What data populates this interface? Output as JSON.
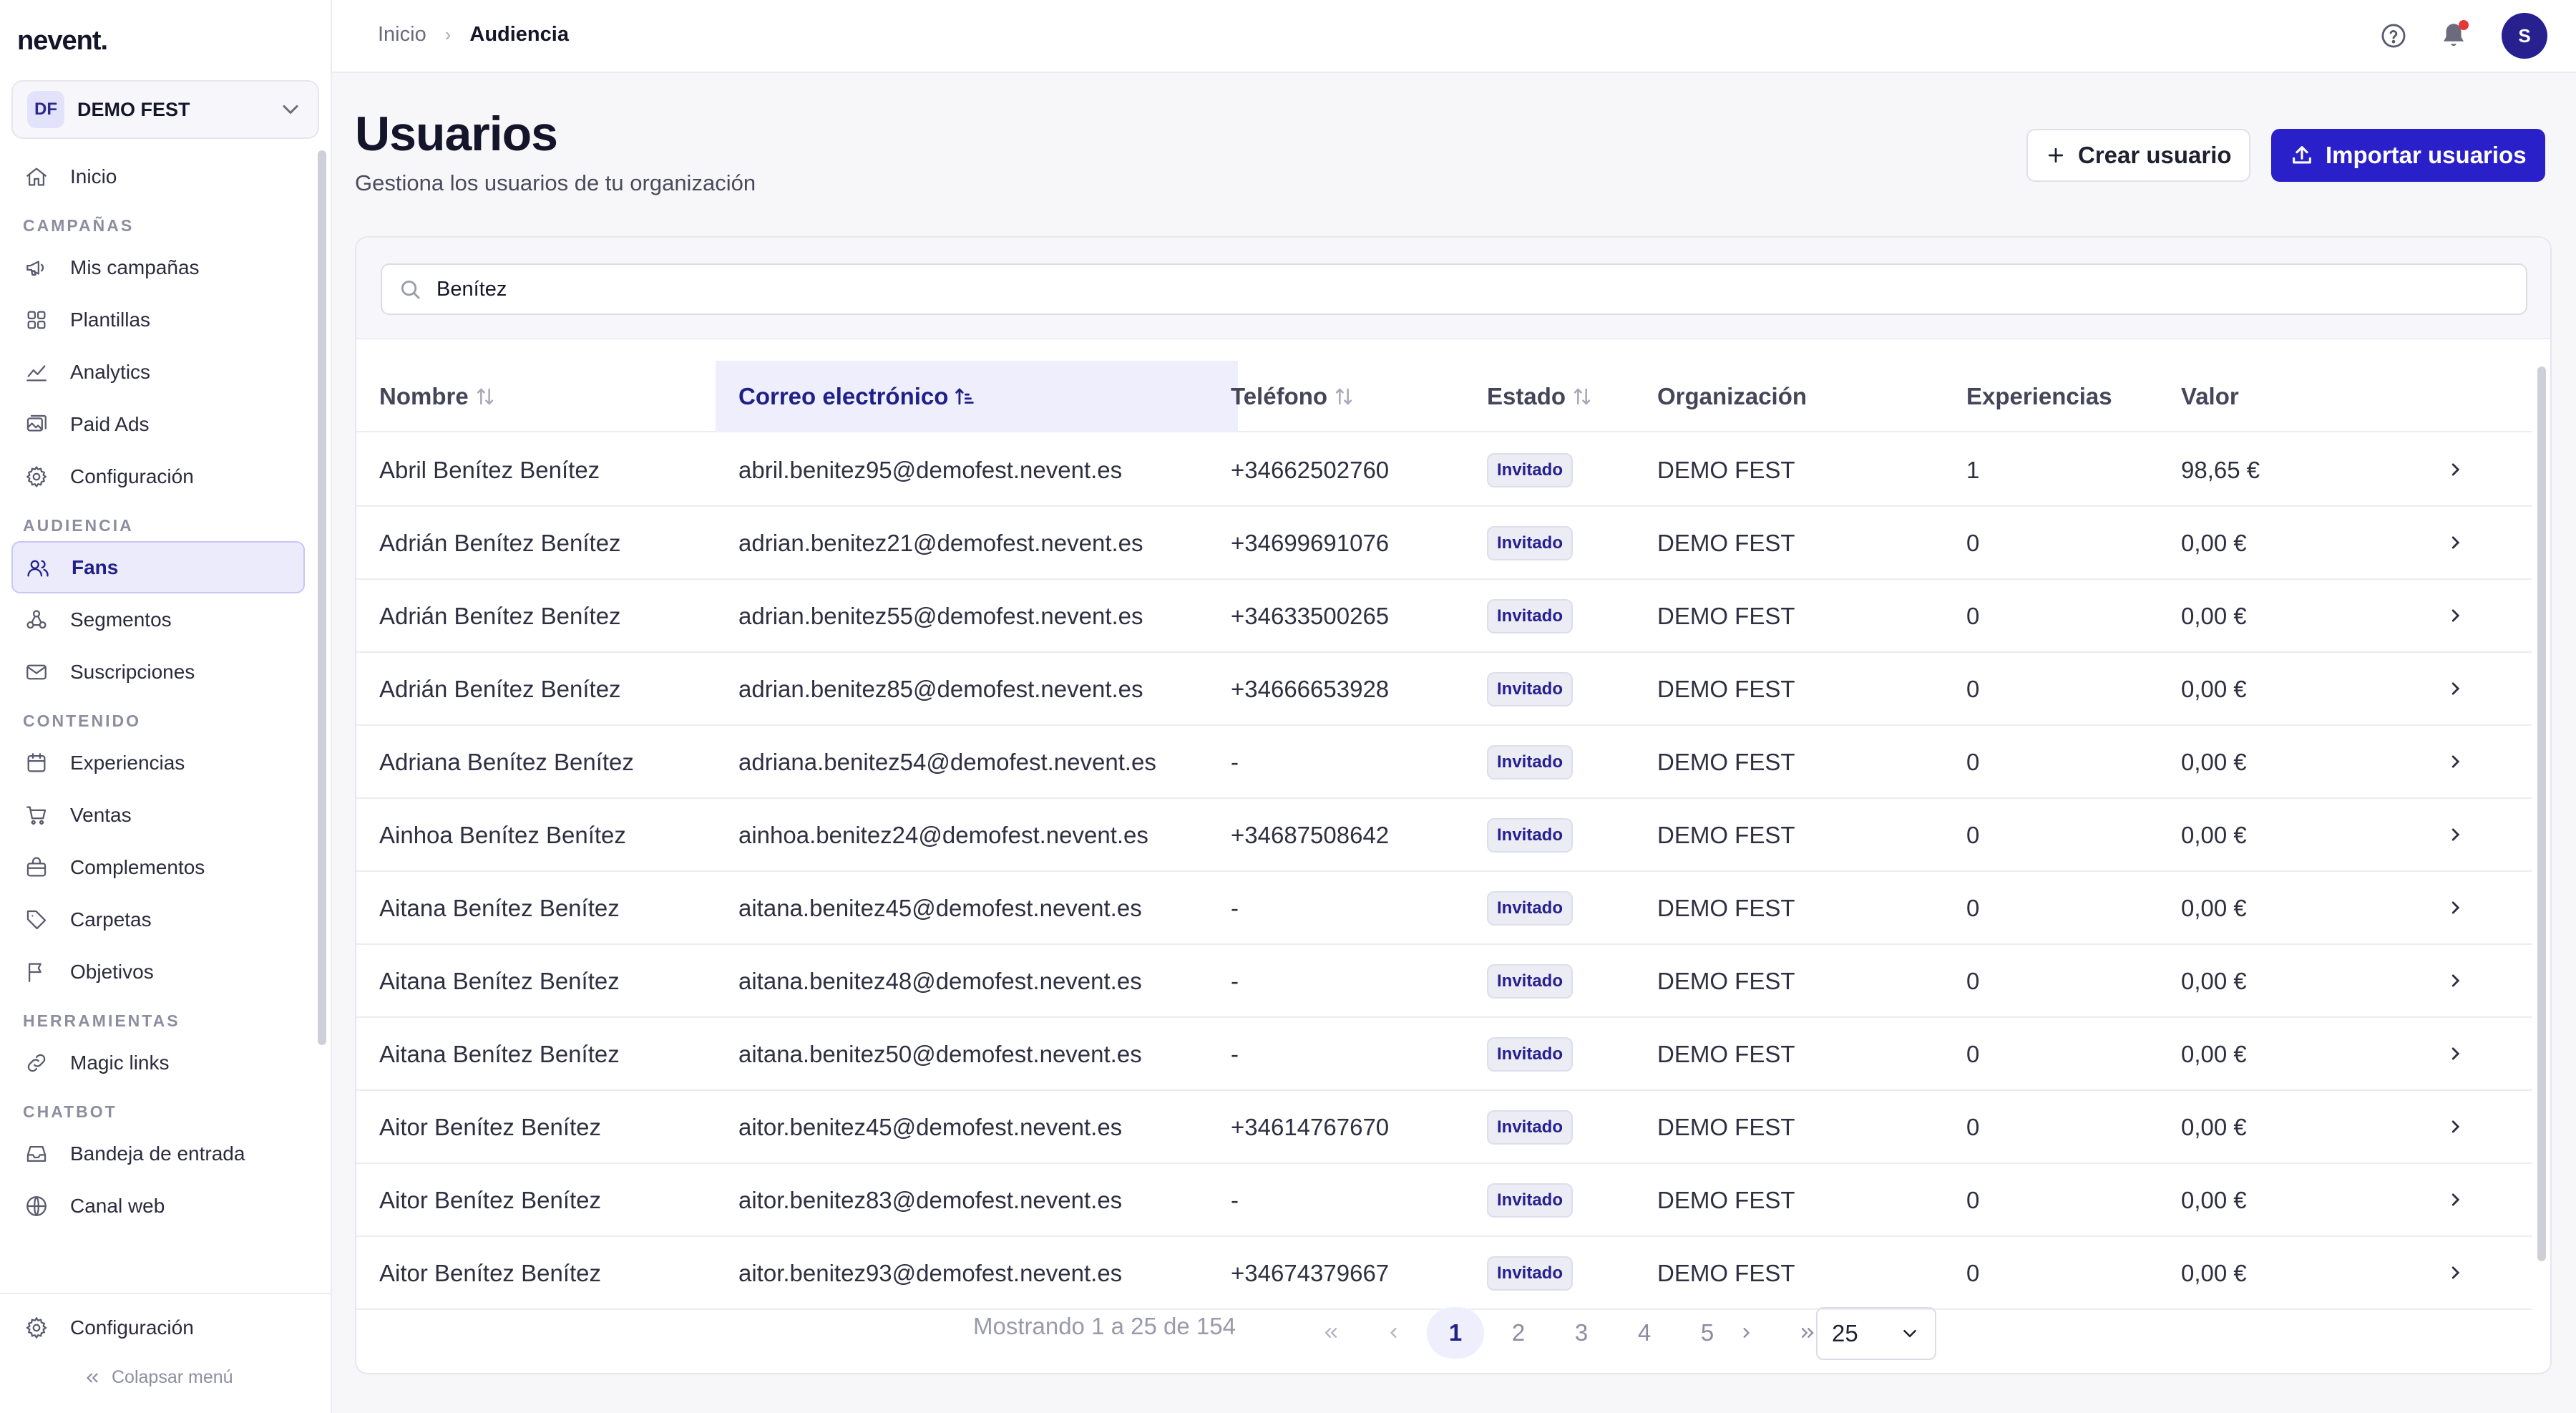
{
  "app": {
    "logo": "nevent."
  },
  "org": {
    "initials": "DF",
    "name": "DEMO FEST"
  },
  "sidebar": {
    "sections": [
      {
        "items": [
          {
            "label": "Inicio",
            "icon": "home-icon"
          }
        ]
      },
      {
        "title": "CAMPAÑAS",
        "items": [
          {
            "label": "Mis campañas",
            "icon": "megaphone-icon"
          },
          {
            "label": "Plantillas",
            "icon": "grid-icon"
          },
          {
            "label": "Analytics",
            "icon": "chart-line-icon"
          },
          {
            "label": "Paid Ads",
            "icon": "image-icon"
          },
          {
            "label": "Configuración",
            "icon": "gear-icon"
          }
        ]
      },
      {
        "title": "AUDIENCIA",
        "items": [
          {
            "label": "Fans",
            "icon": "users-icon",
            "active": true
          },
          {
            "label": "Segmentos",
            "icon": "segments-icon"
          },
          {
            "label": "Suscripciones",
            "icon": "mail-icon"
          }
        ]
      },
      {
        "title": "CONTENIDO",
        "items": [
          {
            "label": "Experiencias",
            "icon": "calendar-icon"
          },
          {
            "label": "Ventas",
            "icon": "cart-icon"
          },
          {
            "label": "Complementos",
            "icon": "bag-icon"
          },
          {
            "label": "Carpetas",
            "icon": "tag-icon"
          },
          {
            "label": "Objetivos",
            "icon": "flag-icon"
          }
        ]
      },
      {
        "title": "HERRAMIENTAS",
        "items": [
          {
            "label": "Magic links",
            "icon": "link-icon"
          }
        ]
      },
      {
        "title": "CHATBOT",
        "items": [
          {
            "label": "Bandeja de entrada",
            "icon": "inbox-icon"
          },
          {
            "label": "Canal web",
            "icon": "globe-icon"
          }
        ]
      }
    ],
    "footer_settings": "Configuración",
    "collapse_label": "Colapsar menú"
  },
  "breadcrumb": {
    "home": "Inicio",
    "current": "Audiencia"
  },
  "user": {
    "initial": "S"
  },
  "header": {
    "title": "Usuarios",
    "subtitle": "Gestiona los usuarios de tu organización",
    "create_button": "Crear usuario",
    "import_button": "Importar usuarios"
  },
  "search": {
    "value": "Benítez",
    "placeholder": ""
  },
  "table": {
    "columns": [
      "Nombre",
      "Correo electrónico",
      "Teléfono",
      "Estado",
      "Organización",
      "Experiencias",
      "Valor"
    ],
    "rows": [
      [
        "Abril Benítez Benítez",
        "abril.benitez95@demofest.nevent.es",
        "+34662502760",
        "Invitado",
        "DEMO FEST",
        "1",
        "98,65 €"
      ],
      [
        "Adrián Benítez Benítez",
        "adrian.benitez21@demofest.nevent.es",
        "+34699691076",
        "Invitado",
        "DEMO FEST",
        "0",
        "0,00 €"
      ],
      [
        "Adrián Benítez Benítez",
        "adrian.benitez55@demofest.nevent.es",
        "+34633500265",
        "Invitado",
        "DEMO FEST",
        "0",
        "0,00 €"
      ],
      [
        "Adrián Benítez Benítez",
        "adrian.benitez85@demofest.nevent.es",
        "+34666653928",
        "Invitado",
        "DEMO FEST",
        "0",
        "0,00 €"
      ],
      [
        "Adriana Benítez Benítez",
        "adriana.benitez54@demofest.nevent.es",
        "-",
        "Invitado",
        "DEMO FEST",
        "0",
        "0,00 €"
      ],
      [
        "Ainhoa Benítez Benítez",
        "ainhoa.benitez24@demofest.nevent.es",
        "+34687508642",
        "Invitado",
        "DEMO FEST",
        "0",
        "0,00 €"
      ],
      [
        "Aitana Benítez Benítez",
        "aitana.benitez45@demofest.nevent.es",
        "-",
        "Invitado",
        "DEMO FEST",
        "0",
        "0,00 €"
      ],
      [
        "Aitana Benítez Benítez",
        "aitana.benitez48@demofest.nevent.es",
        "-",
        "Invitado",
        "DEMO FEST",
        "0",
        "0,00 €"
      ],
      [
        "Aitana Benítez Benítez",
        "aitana.benitez50@demofest.nevent.es",
        "-",
        "Invitado",
        "DEMO FEST",
        "0",
        "0,00 €"
      ],
      [
        "Aitor Benítez Benítez",
        "aitor.benitez45@demofest.nevent.es",
        "+34614767670",
        "Invitado",
        "DEMO FEST",
        "0",
        "0,00 €"
      ],
      [
        "Aitor Benítez Benítez",
        "aitor.benitez83@demofest.nevent.es",
        "-",
        "Invitado",
        "DEMO FEST",
        "0",
        "0,00 €"
      ],
      [
        "Aitor Benítez Benítez",
        "aitor.benitez93@demofest.nevent.es",
        "+34674379667",
        "Invitado",
        "DEMO FEST",
        "0",
        "0,00 €"
      ]
    ]
  },
  "pagination": {
    "summary": "Mostrando 1 a 25 de 154",
    "pages": [
      "1",
      "2",
      "3",
      "4",
      "5"
    ],
    "current": "1",
    "page_size": "25"
  }
}
